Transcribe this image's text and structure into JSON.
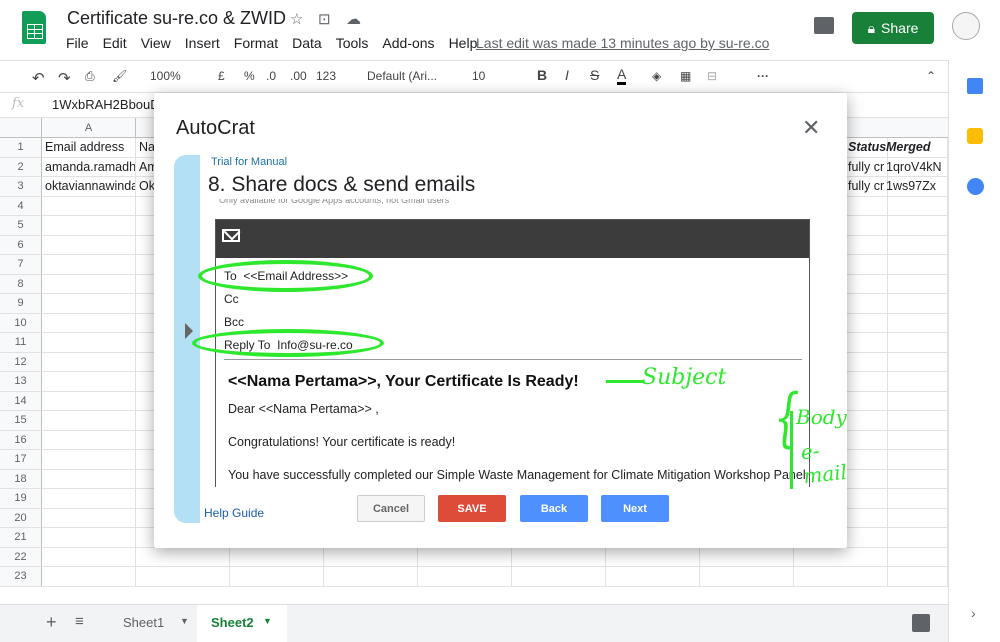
{
  "header": {
    "doc_title": "Certificate su-re.co & ZWID",
    "menu": [
      "File",
      "Edit",
      "View",
      "Insert",
      "Format",
      "Data",
      "Tools",
      "Add-ons",
      "Help"
    ],
    "last_edit": "Last edit was made 13 minutes ago by su-re.co",
    "share_label": "Share"
  },
  "toolbar": {
    "zoom": "100%",
    "currency": "£",
    "percent": "%",
    "dec_less": ".0",
    "dec_more": ".00",
    "format_123": "123",
    "font": "Default (Ari...",
    "font_size": "10",
    "bold": "B",
    "italic": "I",
    "strike": "S",
    "text_color": "A"
  },
  "formula_bar": {
    "fx": "fx",
    "value": "1WxbRAH2BbouD3"
  },
  "grid": {
    "col_a": "A",
    "col_b_partial": "Na",
    "rows": [
      "1",
      "2",
      "3",
      "4",
      "5",
      "6",
      "7",
      "8",
      "9",
      "10",
      "11",
      "12",
      "13",
      "14",
      "15",
      "16",
      "17",
      "18",
      "19",
      "20",
      "21",
      "22",
      "23"
    ],
    "a1": "Email address",
    "a2": "amanda.ramadha",
    "a3": "oktaviannawinda",
    "b2": "Am",
    "b3": "Ok",
    "status_header": "Status",
    "merged_header": "Merged",
    "status_2": "fully cr",
    "status_3": "fully cr",
    "merged_2": "1qroV4kN",
    "merged_3": "1ws97Zx"
  },
  "sheets_tabs": {
    "sheet1": "Sheet1",
    "sheet2": "Sheet2"
  },
  "modal": {
    "title": "AutoCrat",
    "close": "✕",
    "step_sub": "Trial for Manual",
    "step_title": "8. Share docs & send emails",
    "step_note": "Only available for Google Apps accounts, not Gmail users",
    "email": {
      "to_label": "To",
      "to_value": "<<Email Address>>",
      "cc_label": "Cc",
      "bcc_label": "Bcc",
      "reply_label": "Reply To",
      "reply_value": "Info@su-re.co",
      "subject": "<<Nama Pertama>>, Your Certificate Is Ready!",
      "body_1": "Dear <<Nama Pertama>> ,",
      "body_2": "Congratulations! Your certificate is ready!",
      "body_3": "You have successfully completed our Simple Waste Management for Climate Mitigation Workshop Panel"
    },
    "annotation_subject": "Subject",
    "annotation_body_1": "Body",
    "annotation_body_2": "e-mail",
    "help_guide": "Help Guide",
    "buttons": {
      "cancel": "Cancel",
      "save": "SAVE",
      "back": "Back",
      "next": "Next"
    }
  },
  "colors": {
    "share_green": "#188038",
    "save_red": "#dd4b39",
    "blue_btn": "#4d90fe",
    "annotation_green": "#2ee82e",
    "rail_blue": "#b3e0f5"
  }
}
